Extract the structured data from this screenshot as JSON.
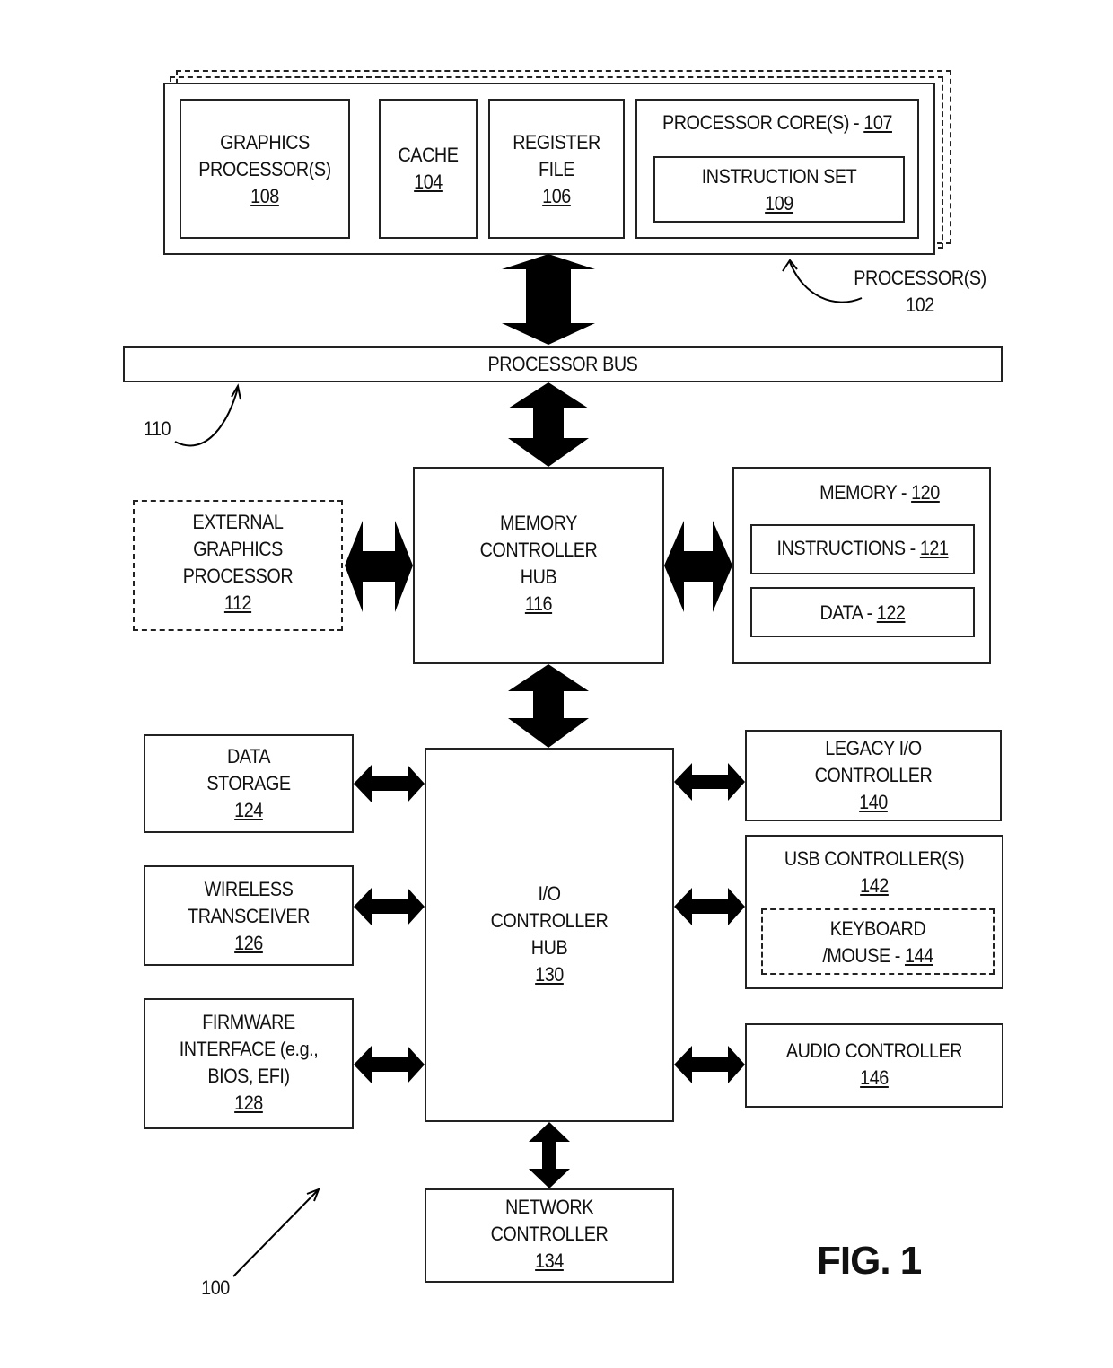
{
  "figure_label": "FIG. 1",
  "system_ref": "100",
  "processor": {
    "label": "PROCESSOR(S)",
    "ref": "102",
    "graphics": {
      "line1": "GRAPHICS",
      "line2": "PROCESSOR(S)",
      "ref": "108"
    },
    "cache": {
      "line1": "CACHE",
      "ref": "104"
    },
    "register_file": {
      "line1": "REGISTER",
      "line2": "FILE",
      "ref": "106"
    },
    "cores": {
      "label": "PROCESSOR CORE(S) - ",
      "ref": "107"
    },
    "instruction_set": {
      "line1": "INSTRUCTION SET",
      "ref": "109"
    }
  },
  "processor_bus": {
    "label": "PROCESSOR BUS",
    "ref": "110"
  },
  "external_graphics": {
    "line1": "EXTERNAL",
    "line2": "GRAPHICS",
    "line3": "PROCESSOR",
    "ref": "112"
  },
  "memory_controller_hub": {
    "line1": "MEMORY",
    "line2": "CONTROLLER",
    "line3": "HUB",
    "ref": "116"
  },
  "memory": {
    "label": "MEMORY - ",
    "ref": "120",
    "instructions": {
      "label": "INSTRUCTIONS - ",
      "ref": "121"
    },
    "data": {
      "label": "DATA - ",
      "ref": "122"
    }
  },
  "io_controller_hub": {
    "line1": "I/O",
    "line2": "CONTROLLER",
    "line3": "HUB",
    "ref": "130"
  },
  "data_storage": {
    "line1": "DATA",
    "line2": "STORAGE",
    "ref": "124"
  },
  "wireless": {
    "line1": "WIRELESS",
    "line2": "TRANSCEIVER",
    "ref": "126"
  },
  "firmware": {
    "line1": "FIRMWARE",
    "line2": "INTERFACE (e.g.,",
    "line3": "BIOS, EFI)",
    "ref": "128"
  },
  "legacy_io": {
    "line1": "LEGACY I/O",
    "line2": "CONTROLLER",
    "ref": "140"
  },
  "usb": {
    "line1": "USB CONTROLLER(S)",
    "ref": "142",
    "keyboard": {
      "line1": "KEYBOARD",
      "line2": "/MOUSE - ",
      "ref": "144"
    }
  },
  "audio": {
    "line1": "AUDIO CONTROLLER",
    "ref": "146"
  },
  "network": {
    "line1": "NETWORK",
    "line2": "CONTROLLER",
    "ref": "134"
  }
}
